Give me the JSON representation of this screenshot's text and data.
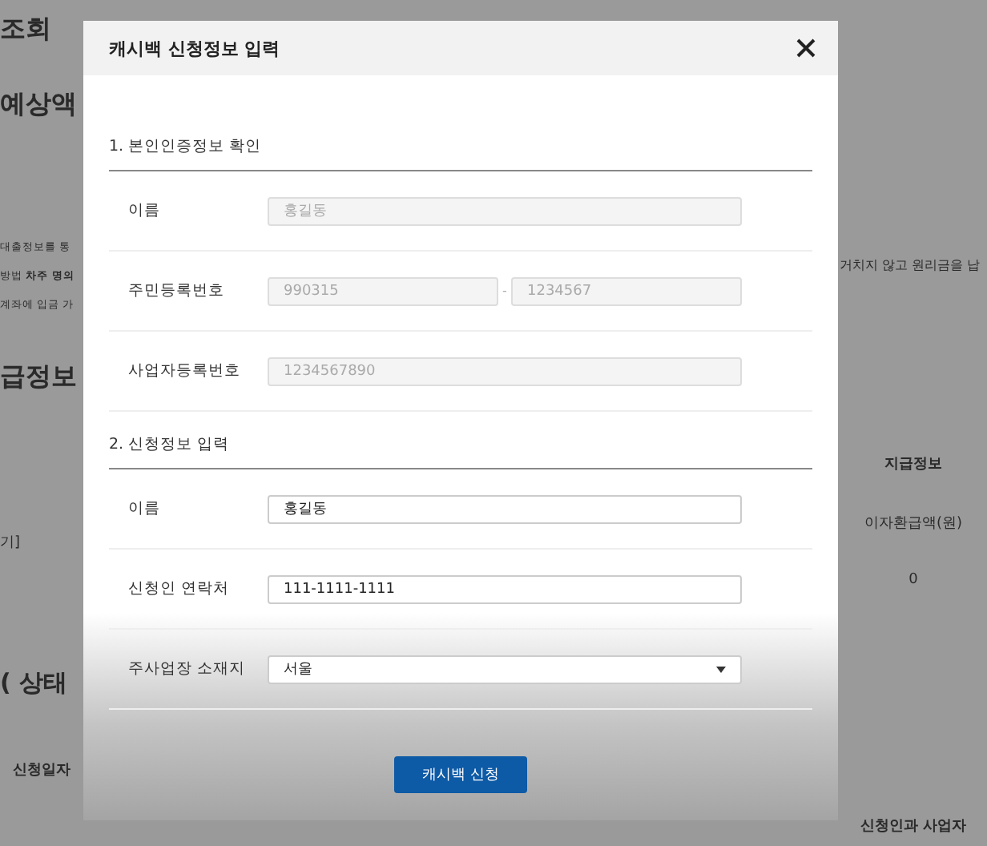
{
  "background_page": {
    "title": "조회",
    "subtitle": "예상액",
    "notes": [
      {
        "text": "대출정보를 통"
      },
      {
        "text": "방법 **차주 명의**"
      },
      {
        "text": "계좌에 입금 가"
      }
    ],
    "right_note": "거치지 않고 원리금을 납",
    "section_title": "급정보",
    "table_left_cell": "기]",
    "table_headers": [
      {
        "label": "지급정보"
      }
    ],
    "table_subheader": "이자환급액(원)",
    "table_value": "0",
    "status_title": "( 상태",
    "bottom_headers": [
      "신청일자",
      "신청인과 사업자"
    ]
  },
  "dialog": {
    "title": "캐시백 신청정보 입력",
    "sections": [
      {
        "title": "1. 본인인증정보 확인",
        "rows": [
          {
            "label": "이름",
            "kind": "text",
            "disabled": true,
            "values": [
              "홍길동"
            ]
          },
          {
            "label": "주민등록번호",
            "kind": "split",
            "disabled": true,
            "separator": "-",
            "values": [
              "990315",
              "1234567"
            ]
          },
          {
            "label": "사업자등록번호",
            "kind": "text",
            "disabled": true,
            "values": [
              "1234567890"
            ]
          }
        ]
      },
      {
        "title": "2. 신청정보 입력",
        "rows": [
          {
            "label": "이름",
            "kind": "text",
            "disabled": false,
            "values": [
              "홍길동"
            ]
          },
          {
            "label": "신청인 연락처",
            "kind": "text",
            "disabled": false,
            "values": [
              "111-1111-1111"
            ]
          },
          {
            "label": "주사업장 소재지",
            "kind": "select",
            "disabled": false,
            "values": [
              "서울"
            ]
          }
        ]
      }
    ],
    "submit": "캐시백 신청"
  }
}
